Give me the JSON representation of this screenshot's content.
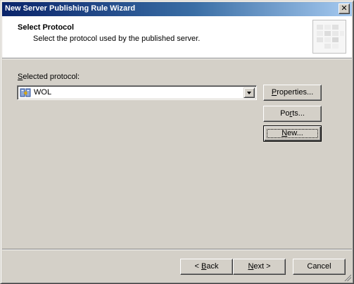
{
  "window": {
    "title": "New Server Publishing Rule Wizard",
    "close_glyph": "✕"
  },
  "header": {
    "title": "Select Protocol",
    "subtitle": "Select the protocol used by the published server.",
    "graphic_icon": "wizard-header-graphic-icon"
  },
  "protocol": {
    "label_prefix": "S",
    "label_rest": "elected protocol:",
    "selected_value": "WOL",
    "icon": "protocol-icon"
  },
  "side_buttons": {
    "properties": {
      "u": "P",
      "rest": "roperties..."
    },
    "ports": {
      "pre": "Po",
      "u": "r",
      "rest": "ts..."
    },
    "new": {
      "u": "N",
      "rest": "ew..."
    }
  },
  "footer": {
    "back": {
      "pre": "< ",
      "u": "B",
      "rest": "ack"
    },
    "next": {
      "u": "N",
      "rest": "ext >"
    },
    "cancel": "Cancel"
  },
  "colors": {
    "title_gradient_start": "#0a246a",
    "title_gradient_end": "#a6caf0",
    "face": "#d4d0c8"
  }
}
